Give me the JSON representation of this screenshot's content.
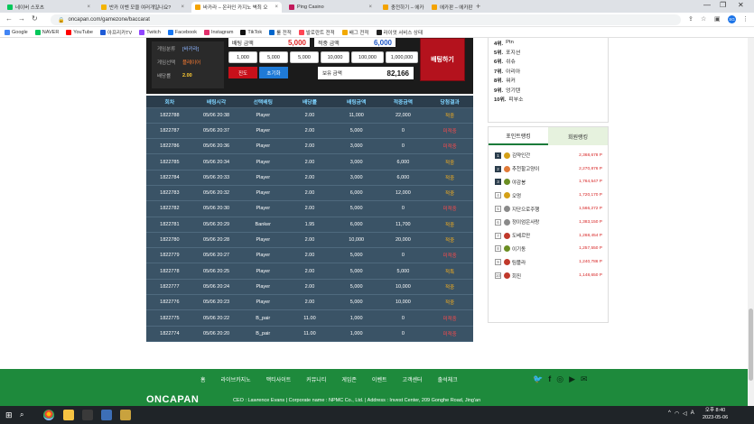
{
  "browser": {
    "tabs": [
      {
        "title": "네이버 스포츠",
        "color": "#03c75a",
        "active": false
      },
      {
        "title": "반카 이벤 모을 여러개일나요?",
        "color": "#f4b400",
        "active": false
      },
      {
        "title": "바카라 – 온라인 카지노 벽최 오",
        "color": "#f4a300",
        "active": true
      },
      {
        "title": "Ping Casino",
        "color": "#c2185b",
        "active": false
      },
      {
        "title": "충전하기 – 에카판 – 아이웨이지",
        "color": "#f4a300",
        "active": false
      },
      {
        "title": "에카판 – 에카판 – 아이웨이지",
        "color": "#f4a300",
        "active": false
      }
    ],
    "url": "oncapan.com/gamezone/baccarat",
    "profile_initial": "SG"
  },
  "bookmarks": [
    {
      "label": "Google",
      "color": "#4285f4"
    },
    {
      "label": "NAVER",
      "color": "#03c75a"
    },
    {
      "label": "YouTube",
      "color": "#ff0000"
    },
    {
      "label": "아프리카TV",
      "color": "#1f5bd6"
    },
    {
      "label": "Twitch",
      "color": "#9146ff"
    },
    {
      "label": "Facebook",
      "color": "#1877f2"
    },
    {
      "label": "Instagram",
      "color": "#e1306c"
    },
    {
      "label": "TikTok",
      "color": "#111111"
    },
    {
      "label": "룰 전적",
      "color": "#0066cc"
    },
    {
      "label": "발로란트 전적",
      "color": "#ff4655"
    },
    {
      "label": "배그 전적",
      "color": "#f2a900"
    },
    {
      "label": "라이엇 서비스 상태",
      "color": "#222222"
    }
  ],
  "game_info": {
    "rows": [
      {
        "key": "게임분류",
        "value": "[바카라]",
        "cls": "v1"
      },
      {
        "key": "게임선택",
        "value": "플레이어",
        "cls": "v2"
      },
      {
        "key": "배당률",
        "value": "2.00",
        "cls": "v3"
      }
    ]
  },
  "bet": {
    "bet_amount_label": "배팅 금액",
    "bet_amount": "5,000",
    "win_amount_label": "적중 금액",
    "win_amount": "6,000",
    "chips": [
      "1,000",
      "5,000",
      "5,000",
      "10,000",
      "100,000",
      "1,000,000"
    ],
    "jindo_label": "진도",
    "reset_label": "초기화",
    "balance_label": "보유 금액",
    "balance": "82,166",
    "submit_label": "배팅하기"
  },
  "history": {
    "headers": [
      "회차",
      "배팅시각",
      "선택배팅",
      "배당률",
      "배팅금액",
      "적중금액",
      "당첨결과"
    ],
    "rows": [
      [
        "1822788",
        "05/06 20:38",
        "Player",
        "2.00",
        "11,000",
        "22,000",
        "적중"
      ],
      [
        "1822787",
        "05/06 20:37",
        "Player",
        "2.00",
        "5,000",
        "0",
        "미적중"
      ],
      [
        "1822786",
        "05/06 20:36",
        "Player",
        "2.00",
        "3,000",
        "0",
        "미적중"
      ],
      [
        "1822785",
        "05/06 20:34",
        "Player",
        "2.00",
        "3,000",
        "6,000",
        "적중"
      ],
      [
        "1822784",
        "05/06 20:33",
        "Player",
        "2.00",
        "3,000",
        "6,000",
        "적중"
      ],
      [
        "1822783",
        "05/06 20:32",
        "Player",
        "2.00",
        "6,000",
        "12,000",
        "적중"
      ],
      [
        "1822782",
        "05/06 20:30",
        "Player",
        "2.00",
        "5,000",
        "0",
        "미적중"
      ],
      [
        "1822781",
        "05/06 20:29",
        "Banker",
        "1.95",
        "6,000",
        "11,700",
        "적중"
      ],
      [
        "1822780",
        "05/06 20:28",
        "Player",
        "2.00",
        "10,000",
        "20,000",
        "적중"
      ],
      [
        "1822779",
        "05/06 20:27",
        "Player",
        "2.00",
        "5,000",
        "0",
        "미적중"
      ],
      [
        "1822778",
        "05/06 20:25",
        "Player",
        "2.00",
        "5,000",
        "5,000",
        "적특"
      ],
      [
        "1822777",
        "05/06 20:24",
        "Player",
        "2.00",
        "5,000",
        "10,000",
        "적중"
      ],
      [
        "1822776",
        "05/06 20:23",
        "Player",
        "2.00",
        "5,000",
        "10,000",
        "적중"
      ],
      [
        "1822775",
        "05/06 20:22",
        "B_pair",
        "11.00",
        "1,000",
        "0",
        "미적중"
      ],
      [
        "1822774",
        "05/06 20:20",
        "B_pair",
        "11.00",
        "1,000",
        "0",
        "미적중"
      ]
    ]
  },
  "ranking": {
    "items": [
      {
        "rank": "4위.",
        "name": "Ptn"
      },
      {
        "rank": "5위.",
        "name": "포지션"
      },
      {
        "rank": "6위.",
        "name": "쉬슈"
      },
      {
        "rank": "7위.",
        "name": "아리아"
      },
      {
        "rank": "8위.",
        "name": "워커"
      },
      {
        "rank": "9위.",
        "name": "엉기텐"
      },
      {
        "rank": "10위.",
        "name": "피부소"
      }
    ]
  },
  "point_ranking": {
    "tab_active": "포인트랭킹",
    "tab_other": "회원랭킹",
    "rows": [
      {
        "num": "1",
        "name": "김약인간",
        "score": "2,368,678 P",
        "face": "#d4a017"
      },
      {
        "num": "2",
        "name": "추천할고양이",
        "score": "2,270,876 P",
        "face": "#e07b39"
      },
      {
        "num": "3",
        "name": "야감봉",
        "score": "1,764,547 P",
        "face": "#6b8e23"
      },
      {
        "num": "4",
        "name": "오멍",
        "score": "1,720,170 P",
        "face": "#d4a017"
      },
      {
        "num": "5",
        "name": "지단으로주행",
        "score": "1,566,272 P",
        "face": "#8a8a8a"
      },
      {
        "num": "6",
        "name": "정이엄은사랑",
        "score": "1,383,150 P",
        "face": "#8a8a8a"
      },
      {
        "num": "7",
        "name": "도베르만",
        "score": "1,268,454 P",
        "face": "#c0392b"
      },
      {
        "num": "8",
        "name": "이기동",
        "score": "1,257,550 P",
        "face": "#6b8e23"
      },
      {
        "num": "9",
        "name": "팀플라",
        "score": "1,240,786 P",
        "face": "#c0392b"
      },
      {
        "num": "10",
        "name": "회진",
        "score": "1,148,650 P",
        "face": "#c0392b"
      }
    ]
  },
  "footer": {
    "nav": [
      "홈",
      "라이브카지노",
      "맥티사이트",
      "커뮤니티",
      "게임존",
      "이벤트",
      "고객센터",
      "출석체크"
    ],
    "logo": "ONCAPAN",
    "info": "CEO : Lawrence Evans   |   Corporate name : NPMC Co., Ltd.   |   Address : Invest Center, 209 Gonghe Road, Jing'an"
  },
  "taskbar": {
    "time": "오후 8:40",
    "date": "2023-05-06",
    "lang": "A"
  }
}
